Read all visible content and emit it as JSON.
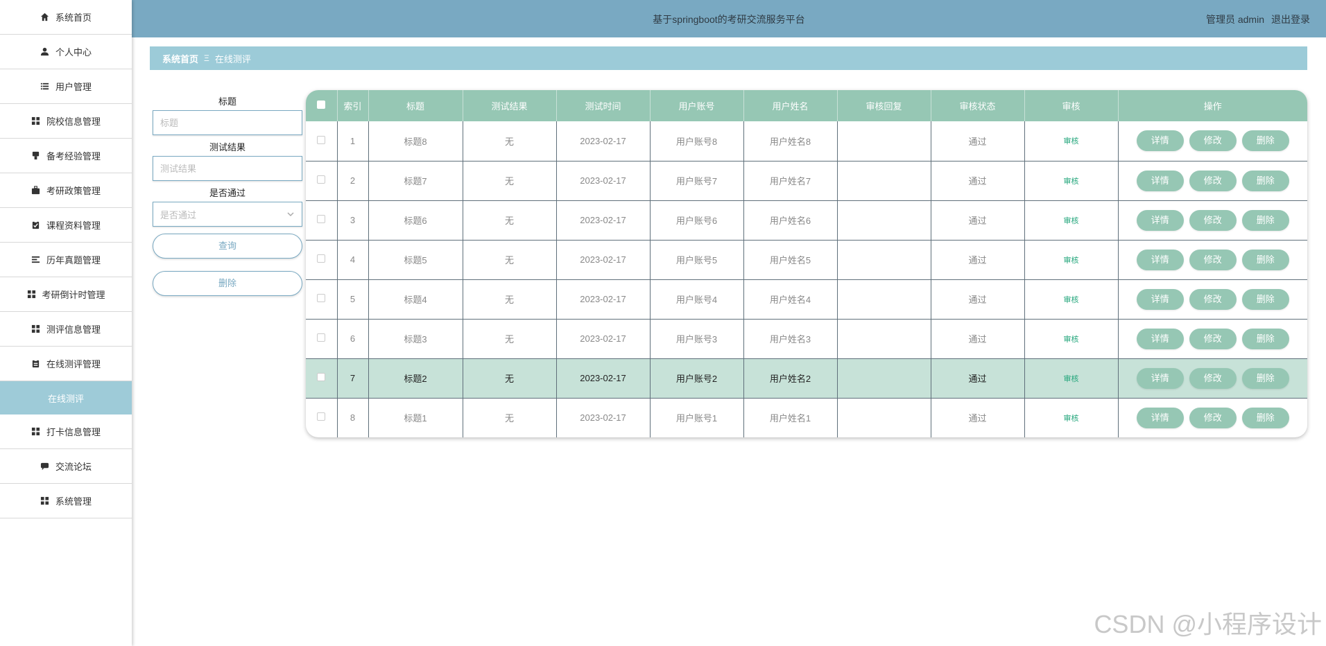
{
  "header": {
    "title": "基于springboot的考研交流服务平台",
    "user": "管理员 admin",
    "logout": "退出登录"
  },
  "sidebar": {
    "items": [
      {
        "label": "系统首页",
        "icon": "home-icon"
      },
      {
        "label": "个人中心",
        "icon": "user-icon"
      },
      {
        "label": "用户管理",
        "icon": "list-icon"
      },
      {
        "label": "院校信息管理",
        "icon": "grid-icon"
      },
      {
        "label": "备考经验管理",
        "icon": "stamp-icon"
      },
      {
        "label": "考研政策管理",
        "icon": "briefcase-icon"
      },
      {
        "label": "课程资料管理",
        "icon": "clipboard-check-icon"
      },
      {
        "label": "历年真题管理",
        "icon": "lines-icon"
      },
      {
        "label": "考研倒计时管理",
        "icon": "grid-icon"
      },
      {
        "label": "测评信息管理",
        "icon": "grid-icon"
      },
      {
        "label": "在线测评管理",
        "icon": "clipboard-icon"
      }
    ],
    "active_sub": "在线测评",
    "items_after": [
      {
        "label": "打卡信息管理",
        "icon": "grid-icon"
      },
      {
        "label": "交流论坛",
        "icon": "chat-icon"
      },
      {
        "label": "系统管理",
        "icon": "grid-icon"
      }
    ]
  },
  "breadcrumb": {
    "home": "系统首页",
    "separator": "Ξ",
    "current": "在线测评"
  },
  "search": {
    "title_label": "标题",
    "title_placeholder": "标题",
    "result_label": "测试结果",
    "result_placeholder": "测试结果",
    "pass_label": "是否通过",
    "pass_placeholder": "是否通过",
    "query_button": "查询",
    "delete_button": "删除"
  },
  "table": {
    "columns": [
      "索引",
      "标题",
      "测试结果",
      "测试时间",
      "用户账号",
      "用户姓名",
      "审核回复",
      "审核状态",
      "审核",
      "操作"
    ],
    "rows": [
      {
        "index": "1",
        "title": "标题8",
        "result": "无",
        "time": "2023-02-17",
        "account": "用户账号8",
        "name": "用户姓名8",
        "reply": "",
        "status": "通过",
        "audit": "审核"
      },
      {
        "index": "2",
        "title": "标题7",
        "result": "无",
        "time": "2023-02-17",
        "account": "用户账号7",
        "name": "用户姓名7",
        "reply": "",
        "status": "通过",
        "audit": "审核"
      },
      {
        "index": "3",
        "title": "标题6",
        "result": "无",
        "time": "2023-02-17",
        "account": "用户账号6",
        "name": "用户姓名6",
        "reply": "",
        "status": "通过",
        "audit": "审核"
      },
      {
        "index": "4",
        "title": "标题5",
        "result": "无",
        "time": "2023-02-17",
        "account": "用户账号5",
        "name": "用户姓名5",
        "reply": "",
        "status": "通过",
        "audit": "审核"
      },
      {
        "index": "5",
        "title": "标题4",
        "result": "无",
        "time": "2023-02-17",
        "account": "用户账号4",
        "name": "用户姓名4",
        "reply": "",
        "status": "通过",
        "audit": "审核"
      },
      {
        "index": "6",
        "title": "标题3",
        "result": "无",
        "time": "2023-02-17",
        "account": "用户账号3",
        "name": "用户姓名3",
        "reply": "",
        "status": "通过",
        "audit": "审核"
      },
      {
        "index": "7",
        "title": "标题2",
        "result": "无",
        "time": "2023-02-17",
        "account": "用户账号2",
        "name": "用户姓名2",
        "reply": "",
        "status": "通过",
        "audit": "审核",
        "highlighted": true
      },
      {
        "index": "8",
        "title": "标题1",
        "result": "无",
        "time": "2023-02-17",
        "account": "用户账号1",
        "name": "用户姓名1",
        "reply": "",
        "status": "通过",
        "audit": "审核"
      }
    ],
    "actions": {
      "detail": "详情",
      "edit": "修改",
      "delete": "删除"
    }
  },
  "watermark": "CSDN @小程序设计",
  "colors": {
    "header": "#79a9c2",
    "breadcrumb": "#9ccbd8",
    "table_header": "#96c7b4",
    "active_menu": "#9ecbd8",
    "highlight_row": "#c7e2d8",
    "audit_link": "#21a57a"
  }
}
